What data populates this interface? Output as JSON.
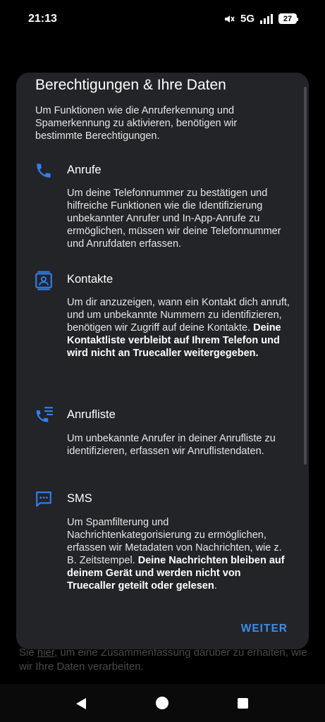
{
  "status_bar": {
    "time": "21:13",
    "network": "5G",
    "battery": "27"
  },
  "background": {
    "text_prefix": "Sie ",
    "link": "hier",
    "text_suffix": ", um eine Zusammenfassung darüber zu erhalten, wie wir Ihre Daten verarbeiten."
  },
  "dialog": {
    "title": "Berechtigungen & Ihre Daten",
    "intro": "Um Funktionen wie die Anruferkennung und Spamerkennung zu aktivieren, benötigen wir bestimmte Berechtigungen.",
    "sections": [
      {
        "icon": "phone-icon",
        "title": "Anrufe",
        "body": "Um deine Telefonnummer zu bestätigen und hilfreiche Funktionen wie die Identifizierung unbekannter Anrufer und In-App-Anrufe zu ermöglichen, müssen wir deine Telefonnummer und Anrufdaten erfassen.",
        "bold": ""
      },
      {
        "icon": "contact-card-icon",
        "title": "Kontakte",
        "body": "Um dir anzuzeigen, wann ein Kontakt dich anruft, und um unbekannte Nummern zu identifizieren, benötigen wir Zugriff auf deine Kontakte. ",
        "bold": "Deine Kontaktliste verbleibt auf Ihrem Telefon und wird nicht an Truecaller weitergegeben."
      },
      {
        "icon": "call-log-icon",
        "title": "Anrufliste",
        "body": "Um unbekannte Anrufer in deiner Anrufliste zu identifizieren, erfassen wir Anruflistendaten.",
        "bold": ""
      },
      {
        "icon": "sms-icon",
        "title": "SMS",
        "body": "Um Spamfilterung und Nachrichtenkategorisierung zu ermöglichen, erfassen wir Metadaten von Nachrichten, wie z. B. Zeitstempel. ",
        "bold": "Deine Nachrichten bleiben auf deinem Gerät und werden nicht von Truecaller geteilt oder gelesen",
        "tail": "."
      }
    ],
    "continue_label": "WEITER"
  },
  "colors": {
    "accent": "#3b8cf0",
    "dialog_bg": "#232427",
    "icon_blue": "#2f7ef5"
  }
}
